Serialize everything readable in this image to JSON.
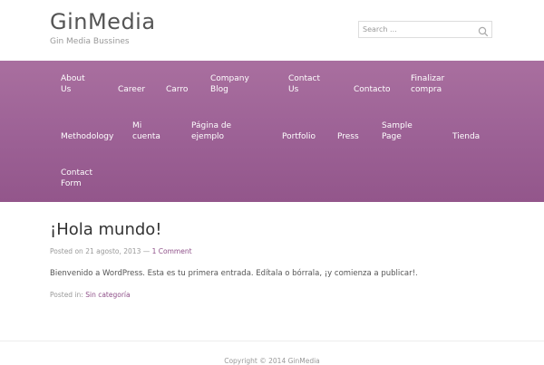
{
  "site": {
    "title": "GinMedia",
    "description": "Gin Media Bussines"
  },
  "search": {
    "placeholder": "Search ..."
  },
  "nav": {
    "items": [
      {
        "label": "About\nUs"
      },
      {
        "label": "Career"
      },
      {
        "label": "Carro"
      },
      {
        "label": "Company\nBlog"
      },
      {
        "label": "Contact\nUs"
      },
      {
        "label": "Contacto"
      },
      {
        "label": "Finalizar\ncompra"
      },
      {
        "label": "Methodology"
      },
      {
        "label": "Mi\ncuenta"
      },
      {
        "label": "Página de\nejemplo"
      },
      {
        "label": "Portfolio"
      },
      {
        "label": "Press"
      },
      {
        "label": "Sample\nPage"
      },
      {
        "label": "Tienda"
      },
      {
        "label": "Contact\nForm"
      }
    ]
  },
  "post": {
    "title": "¡Hola mundo!",
    "posted_on_prefix": "Posted on",
    "date": "21 agosto, 2013",
    "separator": "—",
    "comments_link": "1 Comment",
    "body": "Bienvenido a WordPress. Esta es tu primera entrada. Edítala o bórrala, ¡y comienza a publicar!.",
    "posted_in_prefix": "Posted in:",
    "category": "Sin categoría"
  },
  "footer": {
    "text": "Copyright © 2014 GinMedia"
  },
  "colors": {
    "accent": "#8e4f88",
    "nav_top": "#a96f9f",
    "nav_bottom": "#93568b"
  }
}
